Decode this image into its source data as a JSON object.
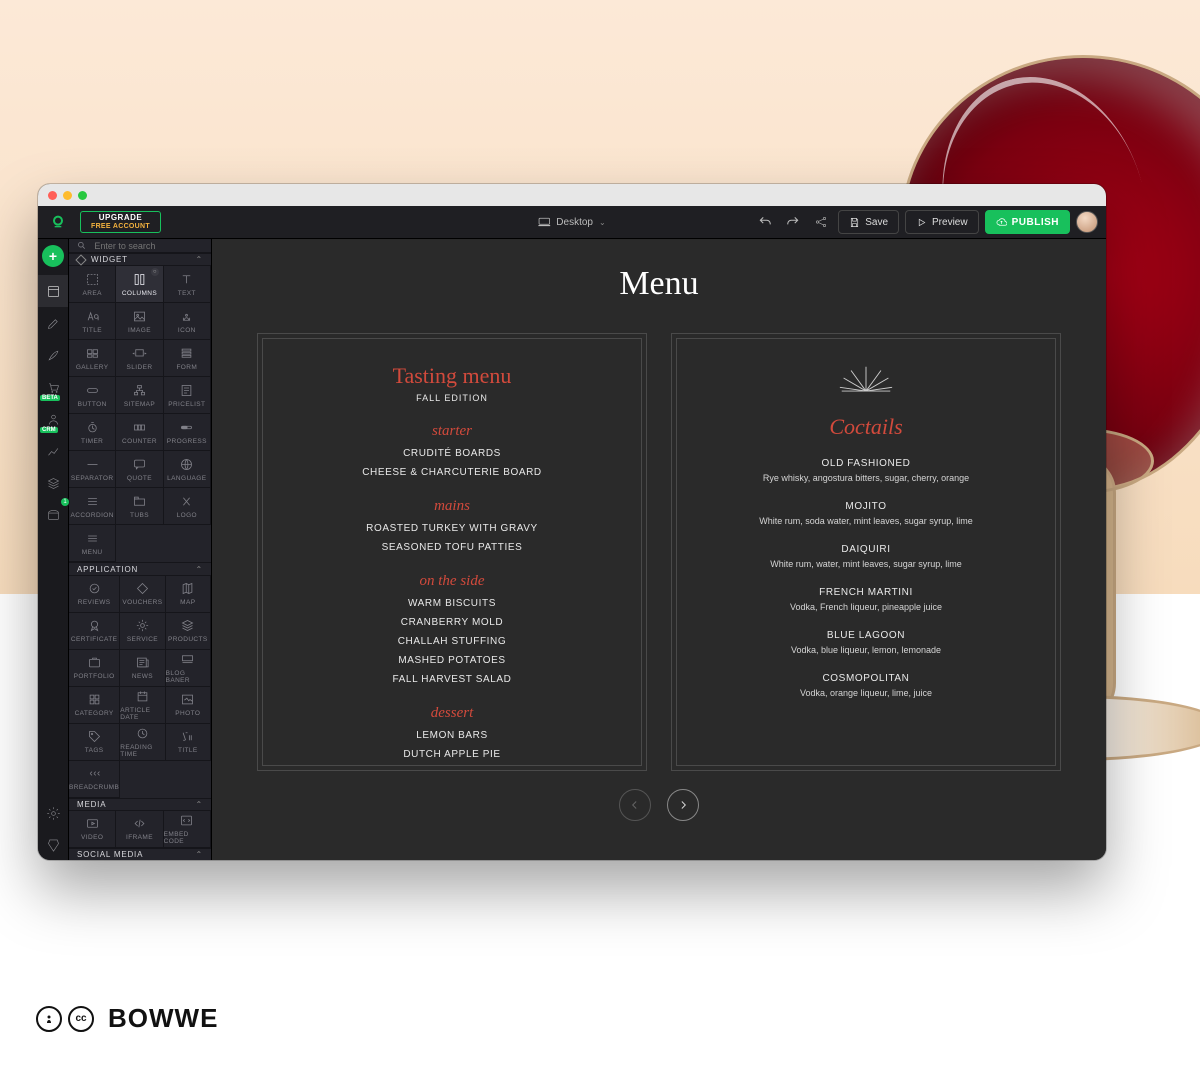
{
  "topbar": {
    "upgrade_line1": "UPGRADE",
    "upgrade_line2": "FREE ACCOUNT",
    "device_label": "Desktop",
    "save_label": "Save",
    "preview_label": "Preview",
    "publish_label": "PUBLISH"
  },
  "search": {
    "placeholder": "Enter to search"
  },
  "sections": {
    "widget": "WIDGET",
    "application": "APPLICATION",
    "media": "MEDIA",
    "social": "SOCIAL MEDIA"
  },
  "widgets": {
    "area": "AREA",
    "columns": "COLUMNS",
    "text": "TEXT",
    "title": "TITLE",
    "image": "IMAGE",
    "icon": "ICON",
    "gallery": "GALLERY",
    "slider": "SLIDER",
    "form": "FORM",
    "button": "BUTTON",
    "sitemap": "SITEMAP",
    "pricelist": "PRICELIST",
    "timer": "TIMER",
    "counter": "COUNTER",
    "progress": "PROGRESS",
    "separator": "SEPARATOR",
    "quote": "QUOTE",
    "language": "LANGUAGE",
    "accordion": "ACCORDION",
    "tubs": "TUBS",
    "logo": "LOGO",
    "menu": "MENU"
  },
  "apps": {
    "reviews": "REVIEWS",
    "vouchers": "VOUCHERS",
    "map": "MAP",
    "certificate": "CERTIFICATE",
    "service": "SERVICE",
    "products": "PRODUCTS",
    "portfolio": "PORTFOLIO",
    "news": "NEWS",
    "blog_banner": "BLOG BANER",
    "category": "CATEGORY",
    "article_date": "ARTICLE DATE",
    "photo": "PHOTO",
    "tags": "TAGS",
    "reading_time": "READING TIME",
    "title2": "TITLE",
    "breadcrumb": "BREADCRUMB"
  },
  "media": {
    "video": "VIDEO",
    "iframe": "IFRAME",
    "embed": "EMBED CODE"
  },
  "rail_tags": {
    "beta": "BETA",
    "crm": "CRM",
    "badge_count": "1"
  },
  "canvas": {
    "page_title": "Menu",
    "tasting": {
      "title": "Tasting menu",
      "subtitle": "FALL EDITION",
      "starter_h": "starter",
      "starter": [
        "CRUDITÉ BOARDS",
        "CHEESE & CHARCUTERIE BOARD"
      ],
      "mains_h": "mains",
      "mains": [
        "ROASTED TURKEY WITH GRAVY",
        "SEASONED TOFU PATTIES"
      ],
      "side_h": "on the side",
      "side": [
        "WARM BISCUITS",
        "CRANBERRY MOLD",
        "CHALLAH STUFFING",
        "MASHED POTATOES",
        "FALL HARVEST SALAD"
      ],
      "dessert_h": "dessert",
      "dessert": [
        "LEMON BARS",
        "DUTCH APPLE PIE"
      ]
    },
    "cocktails": {
      "title": "Coctails",
      "items": [
        {
          "name": "OLD FASHIONED",
          "desc": "Rye whisky, angostura bitters, sugar, cherry, orange"
        },
        {
          "name": "MOJITO",
          "desc": "White rum, soda water, mint leaves, sugar syrup, lime"
        },
        {
          "name": "DAIQUIRI",
          "desc": "White rum, water, mint leaves, sugar syrup, lime"
        },
        {
          "name": "FRENCH MARTINI",
          "desc": "Vodka, French liqueur, pineapple juice"
        },
        {
          "name": "BLUE LAGOON",
          "desc": "Vodka, blue liqueur, lemon, lemonade"
        },
        {
          "name": "COSMOPOLITAN",
          "desc": "Vodka, orange liqueur, lime, juice"
        }
      ]
    }
  },
  "footer": {
    "brand": "BOWWE",
    "cc_person": "ⓘ",
    "cc_cc": "cc"
  }
}
